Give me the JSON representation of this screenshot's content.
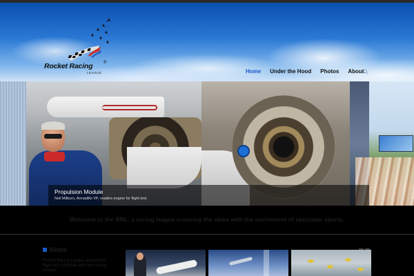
{
  "brand": {
    "logo_text": "Rocket Racing",
    "logo_reg": "®",
    "logo_sub": "LEAGUE"
  },
  "nav": {
    "items": [
      {
        "label": "Home",
        "active": true
      },
      {
        "label": "Under the Hood",
        "active": false
      },
      {
        "label": "Photos",
        "active": false
      },
      {
        "label": "About",
        "active": false
      }
    ],
    "search_icon": "search-icon",
    "active_color": "#1a57c8"
  },
  "slider": {
    "caption_title": "Propulsion Module",
    "caption_sub": "Neil Milburn, Armadillo VP, readies engine for flight test"
  },
  "tagline": "Welcome to the RRL, a racing league crossing the skies with the excitement of spectator sports.",
  "news": {
    "title": "News",
    "text": "Rocket Racing League announces flight test schedule and new racing season."
  }
}
